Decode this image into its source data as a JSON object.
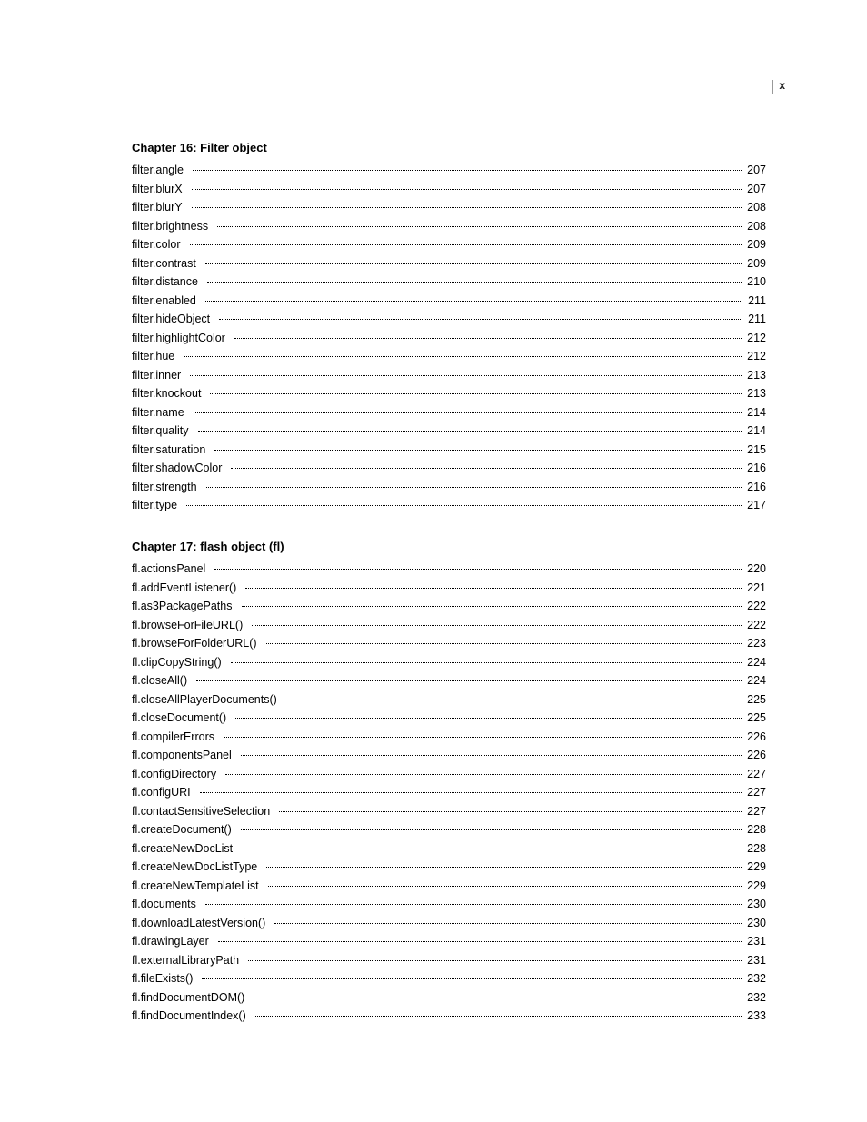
{
  "page_marker": "x",
  "chapters": [
    {
      "title": "Chapter 16: Filter object",
      "entries": [
        {
          "label": "filter.angle",
          "page": "207"
        },
        {
          "label": "filter.blurX",
          "page": "207"
        },
        {
          "label": "filter.blurY",
          "page": "208"
        },
        {
          "label": "filter.brightness",
          "page": "208"
        },
        {
          "label": "filter.color",
          "page": "209"
        },
        {
          "label": "filter.contrast",
          "page": "209"
        },
        {
          "label": "filter.distance",
          "page": "210"
        },
        {
          "label": "filter.enabled",
          "page": "211"
        },
        {
          "label": "filter.hideObject",
          "page": "211"
        },
        {
          "label": "filter.highlightColor",
          "page": "212"
        },
        {
          "label": "filter.hue",
          "page": "212"
        },
        {
          "label": "filter.inner",
          "page": "213"
        },
        {
          "label": "filter.knockout",
          "page": "213"
        },
        {
          "label": "filter.name",
          "page": "214"
        },
        {
          "label": "filter.quality",
          "page": "214"
        },
        {
          "label": "filter.saturation",
          "page": "215"
        },
        {
          "label": "filter.shadowColor",
          "page": "216"
        },
        {
          "label": "filter.strength",
          "page": "216"
        },
        {
          "label": "filter.type",
          "page": "217"
        }
      ]
    },
    {
      "title": "Chapter 17: flash object (fl)",
      "entries": [
        {
          "label": "fl.actionsPanel",
          "page": "220"
        },
        {
          "label": "fl.addEventListener()",
          "page": "221"
        },
        {
          "label": "fl.as3PackagePaths",
          "page": "222"
        },
        {
          "label": "fl.browseForFileURL()",
          "page": "222"
        },
        {
          "label": "fl.browseForFolderURL()",
          "page": "223"
        },
        {
          "label": "fl.clipCopyString()",
          "page": "224"
        },
        {
          "label": "fl.closeAll()",
          "page": "224"
        },
        {
          "label": "fl.closeAllPlayerDocuments()",
          "page": "225"
        },
        {
          "label": "fl.closeDocument()",
          "page": "225"
        },
        {
          "label": "fl.compilerErrors",
          "page": "226"
        },
        {
          "label": "fl.componentsPanel",
          "page": "226"
        },
        {
          "label": "fl.configDirectory",
          "page": "227"
        },
        {
          "label": "fl.configURI",
          "page": "227"
        },
        {
          "label": "fl.contactSensitiveSelection",
          "page": "227"
        },
        {
          "label": "fl.createDocument()",
          "page": "228"
        },
        {
          "label": "fl.createNewDocList",
          "page": "228"
        },
        {
          "label": "fl.createNewDocListType",
          "page": "229"
        },
        {
          "label": "fl.createNewTemplateList",
          "page": "229"
        },
        {
          "label": "fl.documents",
          "page": "230"
        },
        {
          "label": "fl.downloadLatestVersion()",
          "page": "230"
        },
        {
          "label": "fl.drawingLayer",
          "page": "231"
        },
        {
          "label": "fl.externalLibraryPath",
          "page": "231"
        },
        {
          "label": "fl.fileExists()",
          "page": "232"
        },
        {
          "label": "fl.findDocumentDOM()",
          "page": "232"
        },
        {
          "label": "fl.findDocumentIndex()",
          "page": "233"
        }
      ]
    }
  ]
}
